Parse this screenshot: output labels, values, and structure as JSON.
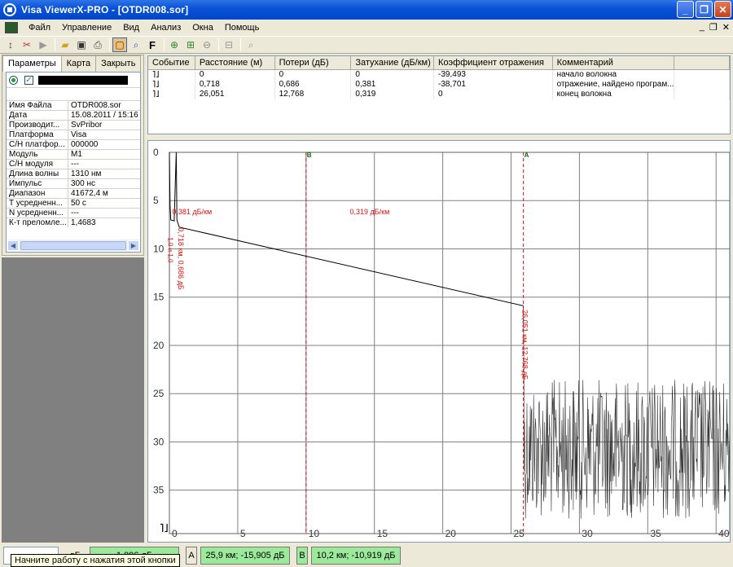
{
  "window": {
    "title": "Visa ViewerX-PRO - [OTDR008.sor]"
  },
  "menu": {
    "items": [
      "Файл",
      "Управление",
      "Вид",
      "Анализ",
      "Окна",
      "Помощь"
    ]
  },
  "toolbar": {
    "f_label": "F"
  },
  "left_panel": {
    "tabs": [
      "Параметры",
      "Карта",
      "Закрыть"
    ],
    "properties": [
      {
        "key": "Имя Файла",
        "value": "OTDR008.sor"
      },
      {
        "key": "Дата",
        "value": "15.08.2011 / 15:16"
      },
      {
        "key": "Производит...",
        "value": "SvPribor"
      },
      {
        "key": "Платформа",
        "value": "Visa"
      },
      {
        "key": "С/Н платфор...",
        "value": "000000"
      },
      {
        "key": "Модуль",
        "value": "M1"
      },
      {
        "key": "С/Н модуля",
        "value": "---"
      },
      {
        "key": "Длина волны",
        "value": "1310 нм"
      },
      {
        "key": "Импульс",
        "value": "300 нс"
      },
      {
        "key": "Диапазон",
        "value": "41672,4 м"
      },
      {
        "key": "Т усредненн...",
        "value": "50 с"
      },
      {
        "key": "N усредненн...",
        "value": "---"
      },
      {
        "key": "К-т преломле...",
        "value": "1,4683"
      }
    ]
  },
  "events": {
    "columns": [
      "Событие",
      "Расстояние (м)",
      "Потери  (дБ)",
      "Затухание  (дБ/км)",
      "Коэффициент отражения",
      "Комментарий"
    ],
    "rows": [
      {
        "distance": "0",
        "loss": "0",
        "attenuation": "0",
        "reflection": "-39,493",
        "comment": "начало волокна"
      },
      {
        "distance": "0,718",
        "loss": "0,686",
        "attenuation": "0,381",
        "reflection": "-38,701",
        "comment": "отражение, найдено програм..."
      },
      {
        "distance": "26,051",
        "loss": "12,768",
        "attenuation": "0,319",
        "reflection": "0",
        "comment": "конец волокна"
      }
    ]
  },
  "graph": {
    "x_ticks": [
      "0",
      "5",
      "10",
      "15",
      "20",
      "25",
      "30",
      "35",
      "40"
    ],
    "y_ticks": [
      "0",
      "5",
      "10",
      "15",
      "20",
      "25",
      "30",
      "35"
    ],
    "x_range": [
      0,
      41
    ],
    "y_range": [
      0,
      39.5
    ],
    "marker_a": {
      "label": "A",
      "x_km": 25.9
    },
    "marker_b": {
      "label": "B",
      "x_km": 10.0
    },
    "annotations": {
      "att1": "0,381 дБ/км",
      "att2": "0,319 дБ/км",
      "event1": "0,718 км, 0,686 дБ",
      "event1_small": "1,0 и 1,0",
      "event2": "26,051 км, 12,768 дБ"
    },
    "trace": {
      "start_y": 7.0,
      "knee_x": 0.72,
      "knee_y": 7.75,
      "end_x": 25.9,
      "end_y": 15.9,
      "noise_start_x": 25.95,
      "noise_min": 23.5,
      "noise_max": 38.0
    },
    "colors": {
      "trace": "#000000",
      "marker": "#e01010",
      "grid": "#808080"
    }
  },
  "status": {
    "db_partial": "дБ",
    "value_partial": "1,096 дБ",
    "a_label": "A",
    "a_value": "25,9 км; -15,905 дБ",
    "b_label": "B",
    "b_value": "10,2 км; -10,919 дБ",
    "tooltip": "Начните работу с нажатия этой кнопки"
  }
}
